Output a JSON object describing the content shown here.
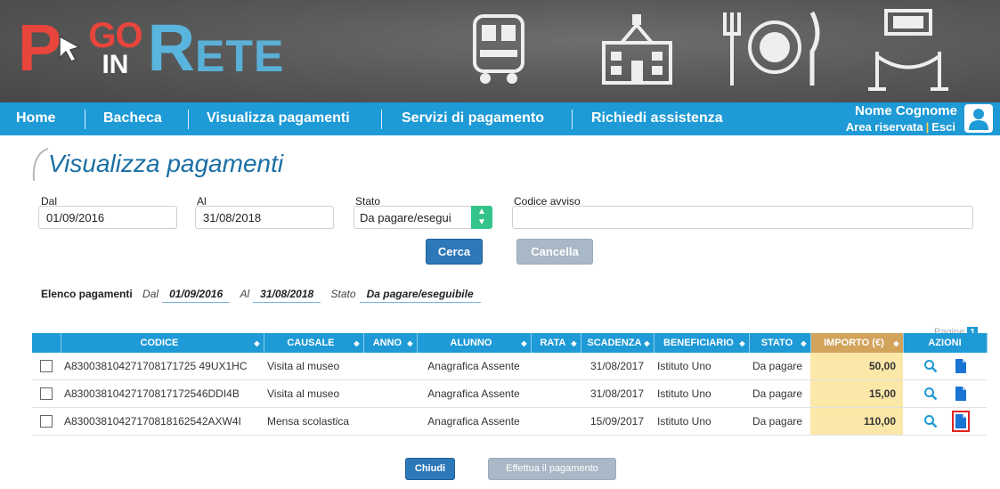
{
  "brand": {
    "p": "P",
    "go": "GO",
    "in": "IN",
    "r": "R",
    "ete": "ETE"
  },
  "nav": {
    "items": [
      "Home",
      "Bacheca",
      "Visualizza pagamenti",
      "Servizi di pagamento",
      "Richiedi assistenza"
    ],
    "user_name": "Nome Cognome",
    "area_riservata": "Area riservata",
    "esci": "Esci"
  },
  "page": {
    "title": "Visualizza pagamenti"
  },
  "filters": {
    "dal_label": "Dal",
    "dal_value": "01/09/2016",
    "al_label": "Al",
    "al_value": "31/08/2018",
    "stato_label": "Stato",
    "stato_value": "Da pagare/esegui",
    "codice_label": "Codice avviso",
    "codice_value": "",
    "cerca": "Cerca",
    "cancella": "Cancella"
  },
  "summary": {
    "label": "Elenco pagamenti",
    "dal_label": "Dal",
    "dal_value": "01/09/2016",
    "al_label": "Al",
    "al_value": "31/08/2018",
    "stato_label": "Stato",
    "stato_value": "Da pagare/eseguibile",
    "pagine_label": "Pagine",
    "pagine_value": "1"
  },
  "table": {
    "headers": [
      "",
      "CODICE",
      "CAUSALE",
      "ANNO",
      "ALUNNO",
      "RATA",
      "SCADENZA",
      "BENEFICIARIO",
      "STATO",
      "IMPORTO (€)",
      "AZIONI"
    ],
    "rows": [
      {
        "codice": "A830038104271708171725 49UX1HC",
        "causale": "Visita al museo",
        "anno": "",
        "alunno": "Anagrafica Assente",
        "rata": "",
        "scadenza": "31/08/2017",
        "beneficiario": "Istituto Uno",
        "stato": "Da pagare",
        "importo": "50,00"
      },
      {
        "codice": "A83003810427170817172546DDI4B",
        "causale": "Visita al museo",
        "anno": "",
        "alunno": "Anagrafica Assente",
        "rata": "",
        "scadenza": "31/08/2017",
        "beneficiario": "Istituto Uno",
        "stato": "Da pagare",
        "importo": "15,00"
      },
      {
        "codice": "A83003810427170818162542AXW4I",
        "causale": "Mensa scolastica",
        "anno": "",
        "alunno": "Anagrafica Assente",
        "rata": "",
        "scadenza": "15/09/2017",
        "beneficiario": "Istituto Uno",
        "stato": "Da pagare",
        "importo": "110,00"
      }
    ]
  },
  "actions": {
    "chiudi": "Chiudi",
    "effettua": "Effettua il pagamento"
  },
  "colors": {
    "nav": "#1e9ad6",
    "brand_red": "#e8453c",
    "brand_blue": "#5ab5de",
    "importo_bg": "#fbe7a8",
    "primary_btn": "#2d78b8"
  }
}
